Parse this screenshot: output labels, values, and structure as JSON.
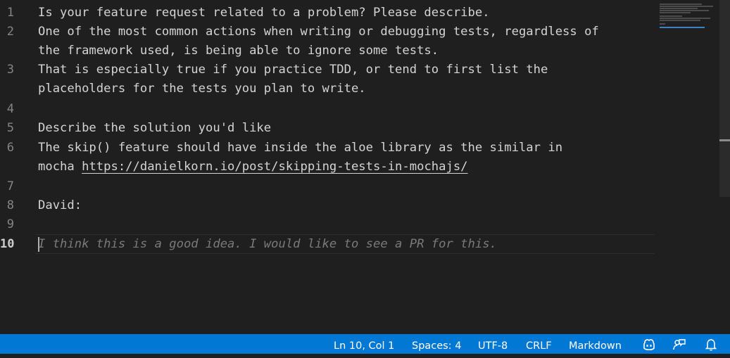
{
  "editor": {
    "line_numbers": [
      "1",
      "2",
      "3",
      "4",
      "5",
      "6",
      "7",
      "8",
      "9",
      "10"
    ],
    "active_line": "10",
    "text_lines": {
      "l1": "Is your feature request related to a problem? Please describe.",
      "l2a": "One of the most common actions when writing or debugging tests, regardless of",
      "l2b": "the framework used, is being able to ignore some tests.",
      "l3a": "That is especially true if you practice TDD, or tend to first list the",
      "l3b": "placeholders for the tests you plan to write.",
      "l5": "Describe the solution you'd like",
      "l6a": "The skip() feature should have inside the aloe library as the similar in",
      "l6b_prefix": "mocha ",
      "l6b_link": "https://danielkorn.io/post/skipping-tests-in-mochajs/",
      "l8": "David:"
    },
    "ghost_suggestion": "I think this is a good idea. I would like to see a PR for this."
  },
  "statusbar": {
    "position": "Ln 10, Col 1",
    "indentation": "Spaces: 4",
    "encoding": "UTF-8",
    "eol": "CRLF",
    "language": "Markdown",
    "icons": [
      "copilot-icon",
      "feedback-icon",
      "notifications-bell-icon"
    ]
  },
  "colors": {
    "editor_background": "#1f1f1f",
    "statusbar_background": "#0078d4",
    "text": "#d4d4d4",
    "line_number": "#858585",
    "ghost_text": "#7a7a7a"
  }
}
